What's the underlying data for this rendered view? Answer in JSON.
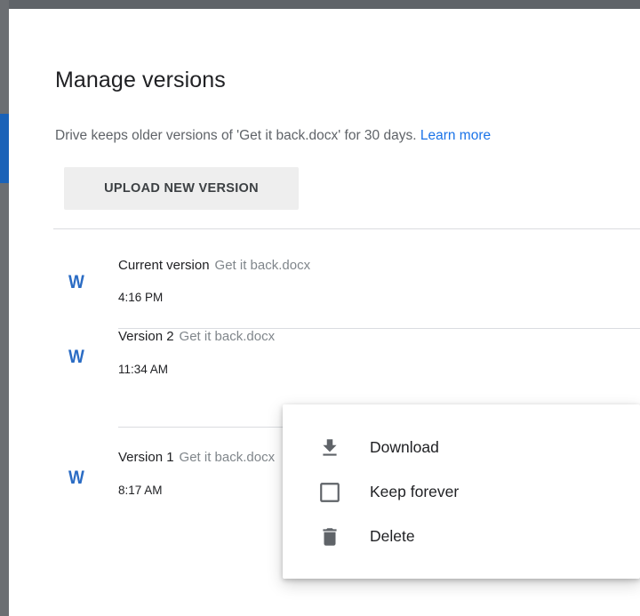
{
  "dialog": {
    "title": "Manage versions",
    "description": "Drive keeps older versions of 'Get it back.docx' for 30 days.",
    "learn_more": "Learn more",
    "upload_button": "UPLOAD NEW VERSION"
  },
  "versions": [
    {
      "icon": "word-icon",
      "icon_letter": "W",
      "label": "Current version",
      "file": "Get it back.docx",
      "time": "4:16 PM"
    },
    {
      "icon": "word-icon",
      "icon_letter": "W",
      "label": "Version 2",
      "file": "Get it back.docx",
      "time": "11:34 AM"
    },
    {
      "icon": "word-icon",
      "icon_letter": "W",
      "label": "Version 1",
      "file": "Get it back.docx",
      "time": "8:17 AM"
    }
  ],
  "context_menu": {
    "items": [
      {
        "icon": "download-icon",
        "label": "Download"
      },
      {
        "icon": "checkbox-icon",
        "label": "Keep forever",
        "checked": false
      },
      {
        "icon": "trash-icon",
        "label": "Delete"
      }
    ]
  },
  "colors": {
    "link": "#1a73e8",
    "word_icon": "#2b6cc4",
    "button_bg": "#eeeeee",
    "frame": "#5f6368",
    "frame_accent": "#1a62b8"
  }
}
